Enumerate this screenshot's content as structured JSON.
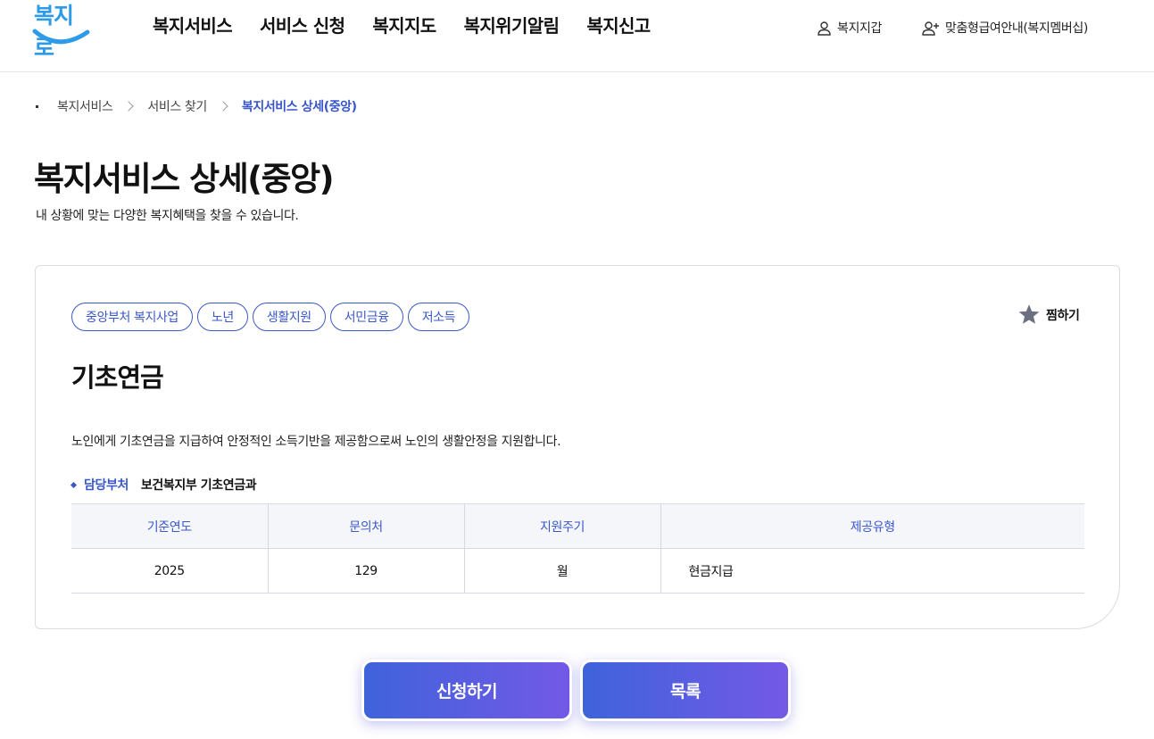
{
  "header": {
    "logo_text": "복지로",
    "nav": [
      "복지서비스",
      "서비스 신청",
      "복지지도",
      "복지위기알림",
      "복지신고"
    ],
    "util_wallet": "복지지갑",
    "util_member": "맞춤형급여안내(복지멤버십)"
  },
  "breadcrumb": [
    "복지서비스",
    "서비스 찾기",
    "복지서비스 상세(중앙)"
  ],
  "page": {
    "title": "복지서비스 상세(중앙)",
    "description": "내 상황에 맞는 다양한 복지혜택을 찾을 수 있습니다."
  },
  "service": {
    "tags": [
      "중앙부처 복지사업",
      "노년",
      "생활지원",
      "서민금융",
      "저소득"
    ],
    "favorite_label": "찜하기",
    "name": "기초연금",
    "description": "노인에게 기초연금을 지급하여 안정적인 소득기반을 제공함으로써 노인의 생활안정을 지원합니다.",
    "dept_label": "담당부처",
    "dept_value": "보건복지부 기초연금과",
    "table": {
      "headers": [
        "기준연도",
        "문의처",
        "지원주기",
        "제공유형"
      ],
      "row": [
        "2025",
        "129",
        "월",
        "현금지급"
      ]
    }
  },
  "buttons": {
    "apply": "신청하기",
    "list": "목록"
  },
  "colors": {
    "accent": "#3b58c9",
    "logo": "#2e9be8",
    "button_gradient_start": "#3f63db",
    "button_gradient_end": "#7359e6",
    "favorite_star": "#6b6f80"
  }
}
